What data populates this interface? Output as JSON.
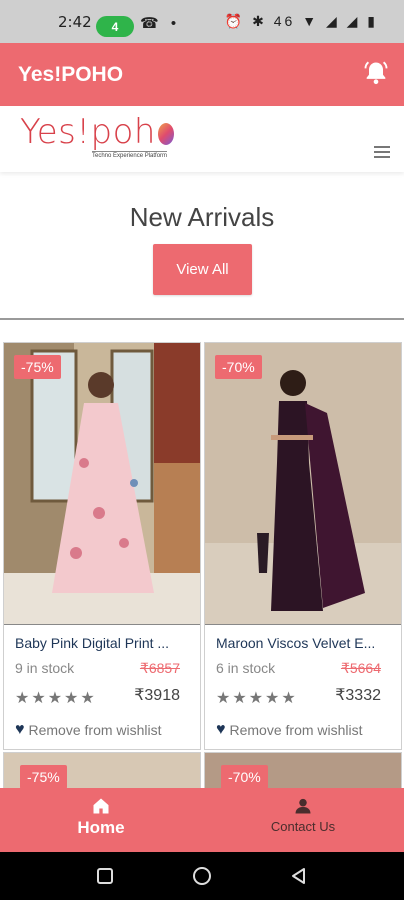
{
  "status_bar": {
    "time": "2:42",
    "call_count": "4",
    "left_icons": "☎ •",
    "right_icons": "⏰ ✱ 46 ▼ ◢ ◢ ▮"
  },
  "app_bar": {
    "title": "Yes!POHO"
  },
  "header": {
    "logo_text": "Yes!poh",
    "logo_tagline": "Techno Experience Platform"
  },
  "section": {
    "title": "New Arrivals",
    "view_all_label": "View All"
  },
  "products": [
    {
      "discount": "-75%",
      "name": "Baby Pink Digital Print ...",
      "stock": "9 in stock",
      "old_price": "₹6857",
      "price": "₹3918",
      "rating": 0,
      "stars": "★★★★★",
      "wishlist_label": "Remove from wishlist"
    },
    {
      "discount": "-70%",
      "name": "Maroon Viscos Velvet E...",
      "stock": "6 in stock",
      "old_price": "₹5664",
      "price": "₹3332",
      "rating": 0,
      "stars": "★★★★★",
      "wishlist_label": "Remove from wishlist"
    }
  ],
  "next_row": [
    {
      "discount": "-75%"
    },
    {
      "discount": "-70%"
    }
  ],
  "bottom_nav": {
    "home_label": "Home",
    "contact_label": "Contact Us"
  },
  "colors": {
    "accent": "#ed6a70",
    "product_name": "#1e3657"
  },
  "icons": {
    "bell": "bell-icon",
    "menu": "hamburger-menu-icon",
    "heart": "heart-icon",
    "home": "home-icon",
    "contact": "person-icon"
  }
}
